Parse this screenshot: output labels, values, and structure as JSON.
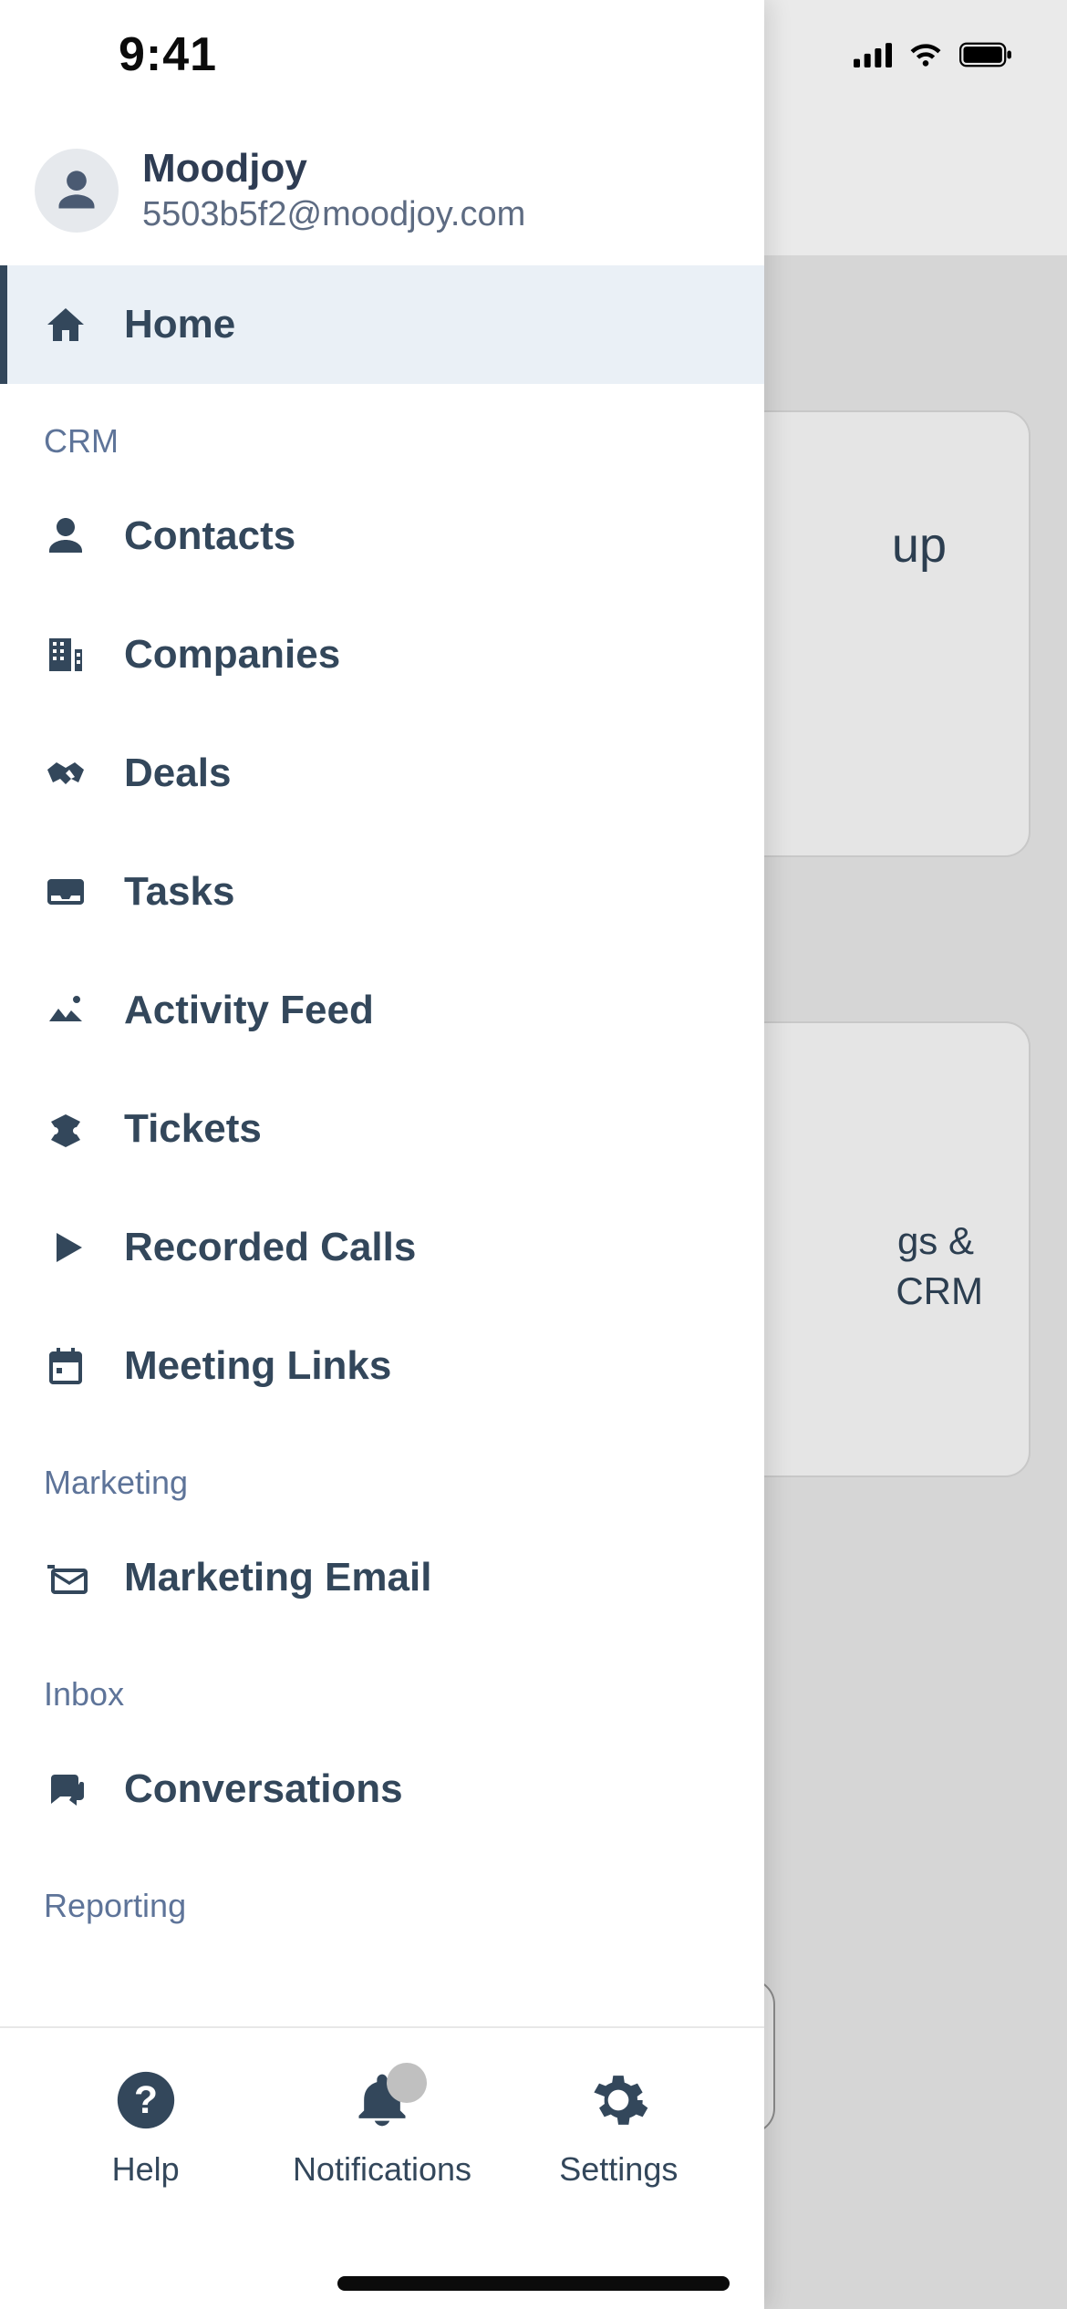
{
  "status": {
    "time": "9:41"
  },
  "profile": {
    "name": "Moodjoy",
    "email": "5503b5f2@moodjoy.com"
  },
  "nav": {
    "home": "Home",
    "sections": [
      {
        "title": "CRM",
        "items": [
          {
            "icon": "person-icon",
            "label": "Contacts"
          },
          {
            "icon": "building-icon",
            "label": "Companies"
          },
          {
            "icon": "handshake-icon",
            "label": "Deals"
          },
          {
            "icon": "tray-icon",
            "label": "Tasks"
          },
          {
            "icon": "activity-icon",
            "label": "Activity Feed"
          },
          {
            "icon": "ticket-icon",
            "label": "Tickets"
          },
          {
            "icon": "play-icon",
            "label": "Recorded Calls"
          },
          {
            "icon": "calendar-icon",
            "label": "Meeting Links"
          }
        ]
      },
      {
        "title": "Marketing",
        "items": [
          {
            "icon": "email-icon",
            "label": "Marketing Email"
          }
        ]
      },
      {
        "title": "Inbox",
        "items": [
          {
            "icon": "chat-icon",
            "label": "Conversations"
          }
        ]
      },
      {
        "title": "Reporting",
        "items": []
      }
    ]
  },
  "bottom": {
    "help": "Help",
    "notifications": "Notifications",
    "settings": "Settings"
  },
  "background": {
    "fragment1": "up",
    "fragment2a": "gs &",
    "fragment2b": "CRM"
  }
}
